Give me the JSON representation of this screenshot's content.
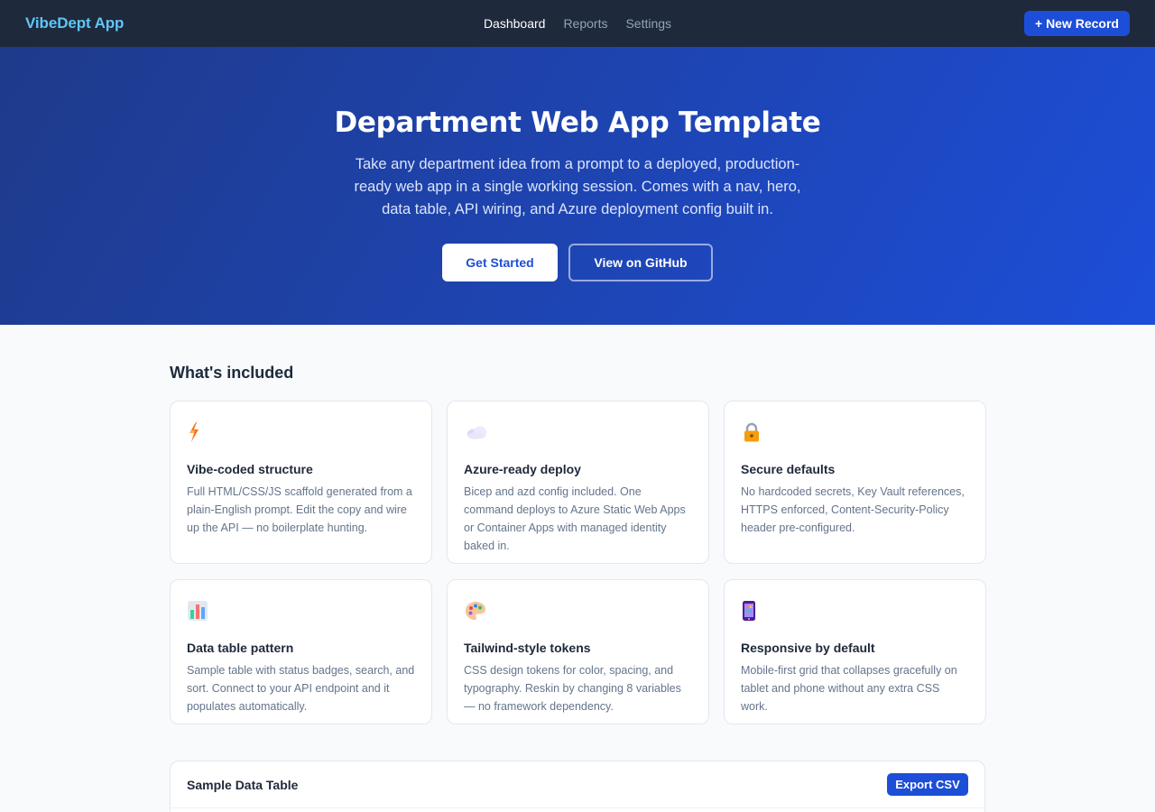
{
  "nav": {
    "brand": "VibeDept App",
    "links": [
      "Dashboard",
      "Reports",
      "Settings"
    ],
    "active": "Dashboard",
    "new_record_label": "+ New Record"
  },
  "hero": {
    "title": "Department Web App Template",
    "subtitle": "Take any department idea from a prompt to a deployed, production-ready web app in a single working session. Comes with a nav, hero, data table, API wiring, and Azure deployment config built in.",
    "primary_cta": "Get Started",
    "secondary_cta": "View on GitHub"
  },
  "features": {
    "heading": "What's included",
    "cards": [
      {
        "icon": "lightning-icon",
        "title": "Vibe-coded structure",
        "text": "Full HTML/CSS/JS scaffold generated from a plain-English prompt. Edit the copy and wire up the API — no boilerplate hunting."
      },
      {
        "icon": "cloud-icon",
        "title": "Azure-ready deploy",
        "text": "Bicep and azd config included. One command deploys to Azure Static Web Apps or Container Apps with managed identity baked in."
      },
      {
        "icon": "lock-icon",
        "title": "Secure defaults",
        "text": "No hardcoded secrets, Key Vault references, HTTPS enforced, Content-Security-Policy header pre-configured."
      },
      {
        "icon": "bar-chart-icon",
        "title": "Data table pattern",
        "text": "Sample table with status badges, search, and sort. Connect to your API endpoint and it populates automatically."
      },
      {
        "icon": "palette-icon",
        "title": "Tailwind-style tokens",
        "text": "CSS design tokens for color, spacing, and typography. Reskin by changing 8 variables — no framework dependency."
      },
      {
        "icon": "mobile-phone-icon",
        "title": "Responsive by default",
        "text": "Mobile-first grid that collapses gracefully on tablet and phone without any extra CSS work."
      }
    ]
  },
  "table": {
    "title": "Sample Data Table",
    "export_label": "Export CSV"
  },
  "colors": {
    "nav_bg": "#1e293b",
    "brand": "#60c5f7",
    "accent": "#1d4ed8",
    "hero_start": "#1e3a8a",
    "hero_end": "#1d4ed8",
    "page_bg": "#f8fafc"
  }
}
